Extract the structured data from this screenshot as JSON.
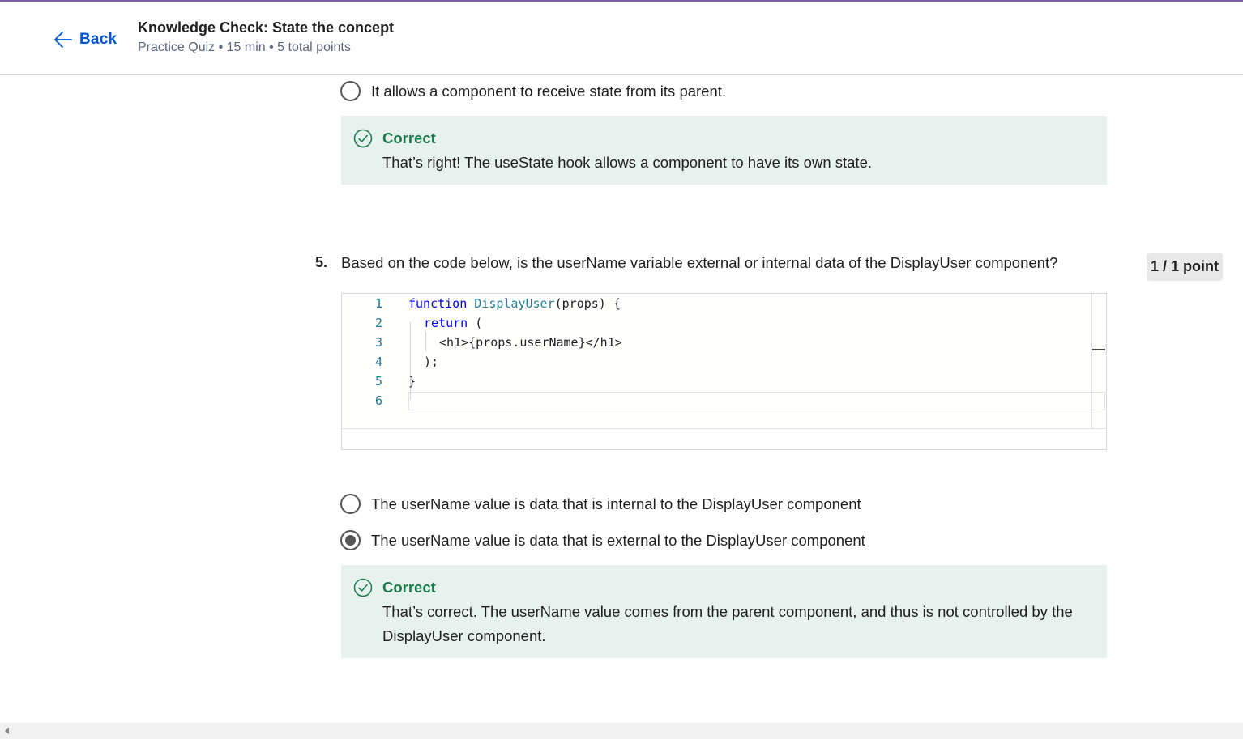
{
  "header": {
    "back_label": "Back",
    "title": "Knowledge Check: State the concept",
    "subtitle": "Practice Quiz • 15 min • 5 total points"
  },
  "q4": {
    "option_last": "It allows a component to receive state from its parent.",
    "feedback": {
      "title": "Correct",
      "text": "That’s right! The useState hook allows a component to have its own state."
    }
  },
  "q5": {
    "number": "5.",
    "question": "Based on the code below, is the userName variable external or internal data of the DisplayUser component?",
    "points": "1 / 1 point",
    "code": {
      "line_numbers": [
        "1",
        "2",
        "3",
        "4",
        "5",
        "6"
      ],
      "l1_kw": "function",
      "l1_fn": "DisplayUser",
      "l1_rest": "(props) {",
      "l2_kw": "return",
      "l2_rest": " (",
      "l3": "<h1>{props.userName}</h1>",
      "l4": ");",
      "l5": "}",
      "l6": ""
    },
    "options": [
      {
        "label": "The userName value is data that is internal to the DisplayUser component",
        "selected": false
      },
      {
        "label": "The userName value is data that is external to the DisplayUser component",
        "selected": true
      }
    ],
    "feedback": {
      "title": "Correct",
      "text": "That’s correct. The userName value comes from the parent component, and thus is not controlled by the DisplayUser component."
    }
  },
  "colors": {
    "accent_top": "#7b5ea7",
    "link": "#0056d2",
    "correct_bg": "#e7f1ed",
    "correct_text": "#1a7a4a"
  }
}
